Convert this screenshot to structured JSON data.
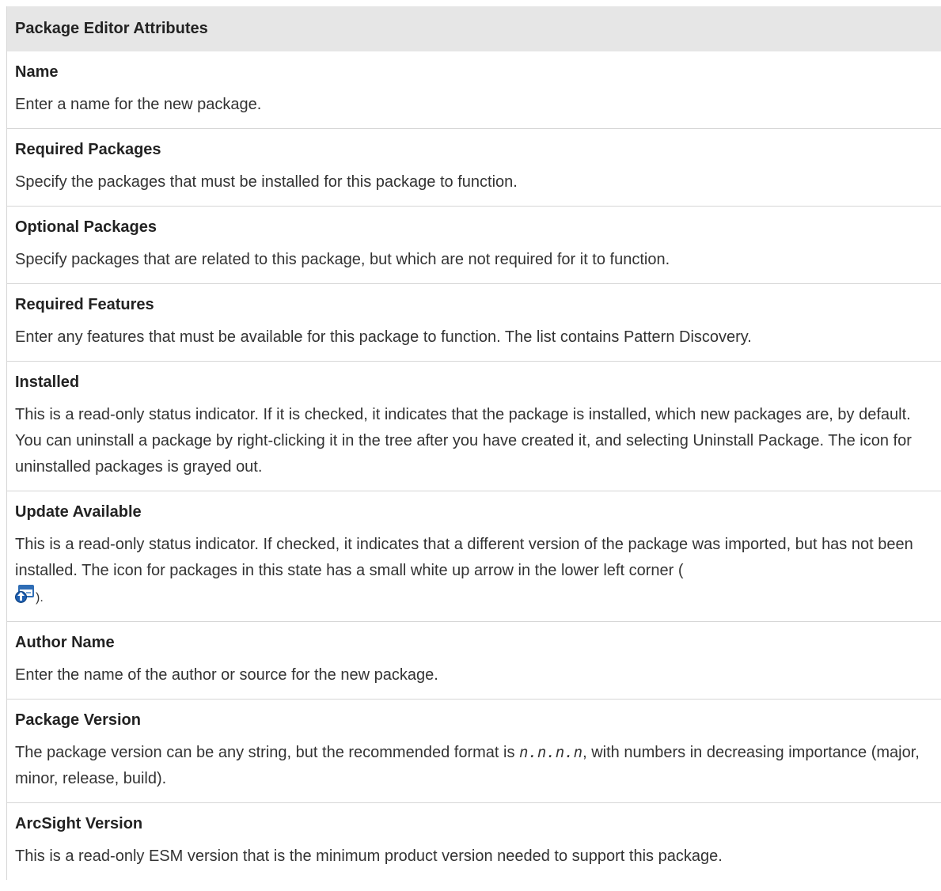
{
  "table": {
    "header": "Package Editor Attributes",
    "rows": [
      {
        "term": "Name",
        "desc": "Enter a name for the new package."
      },
      {
        "term": "Required Packages",
        "desc": "Specify the packages that must be installed for this package to function."
      },
      {
        "term": "Optional Packages",
        "desc": "Specify packages that are related to this package, but which are not required for it to function."
      },
      {
        "term": "Required Features",
        "desc": "Enter any features that must be available for this package to function. The list contains Pattern Discovery."
      },
      {
        "term": "Installed",
        "desc": "This is a read-only status indicator. If it is checked, it indicates that the package is installed, which new packages are, by default. You can uninstall a package by right-clicking it in the tree after you have created it, and selecting Uninstall Package. The icon for uninstalled packages is grayed out."
      },
      {
        "term": "Update Available",
        "desc": "This is a read-only status indicator. If checked, it indicates that a different version of the package was imported, but has not been installed. The icon for packages in this state has a small white up arrow in the lower left corner (",
        "desc_end": ")."
      },
      {
        "term": "Author Name",
        "desc": "Enter the name of the author or source for the new package."
      },
      {
        "term": "Package Version",
        "desc_pre": "The package version can be any string, but the recommended format is ",
        "desc_code": "n.n.n.n",
        "desc_post": ", with numbers in decreasing importance (major, minor, release, build)."
      },
      {
        "term": "ArcSight Version",
        "desc": "This is a read-only ESM version that is the minimum product version needed to support this package."
      }
    ]
  },
  "icons": {
    "update_icon": "package-update-available-icon"
  }
}
